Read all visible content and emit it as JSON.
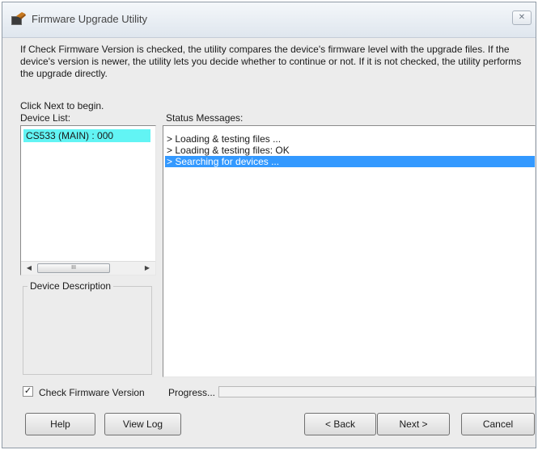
{
  "window": {
    "title": "Firmware Upgrade Utility",
    "close_icon": "close-icon"
  },
  "instructions": {
    "description": "If Check Firmware Version is checked, the utility compares the device's firmware level with the upgrade files. If the device's version is newer, the utility lets you decide whether to continue or not. If it is not checked, the utility performs the upgrade directly.",
    "hint": "Click Next to begin."
  },
  "device_list": {
    "label": "Device List:",
    "items": [
      "CS533 (MAIN) : 000"
    ],
    "selected_index": 0,
    "scroll_thumb_glyph": "III"
  },
  "status": {
    "label": "Status Messages:",
    "messages": [
      "> Loading & testing files ...",
      "> Loading & testing files: OK",
      "> Searching for devices ..."
    ],
    "highlighted_index": 2
  },
  "device_description": {
    "label": "Device Description"
  },
  "check_firmware": {
    "label": "Check Firmware Version",
    "checked": true
  },
  "progress": {
    "label": "Progress...",
    "value": 0
  },
  "buttons": {
    "help": "Help",
    "view_log": "View Log",
    "back": "< Back",
    "next": "Next >",
    "cancel": "Cancel"
  },
  "colors": {
    "selection": "#3399ff",
    "device_highlight": "#62f4f4"
  }
}
